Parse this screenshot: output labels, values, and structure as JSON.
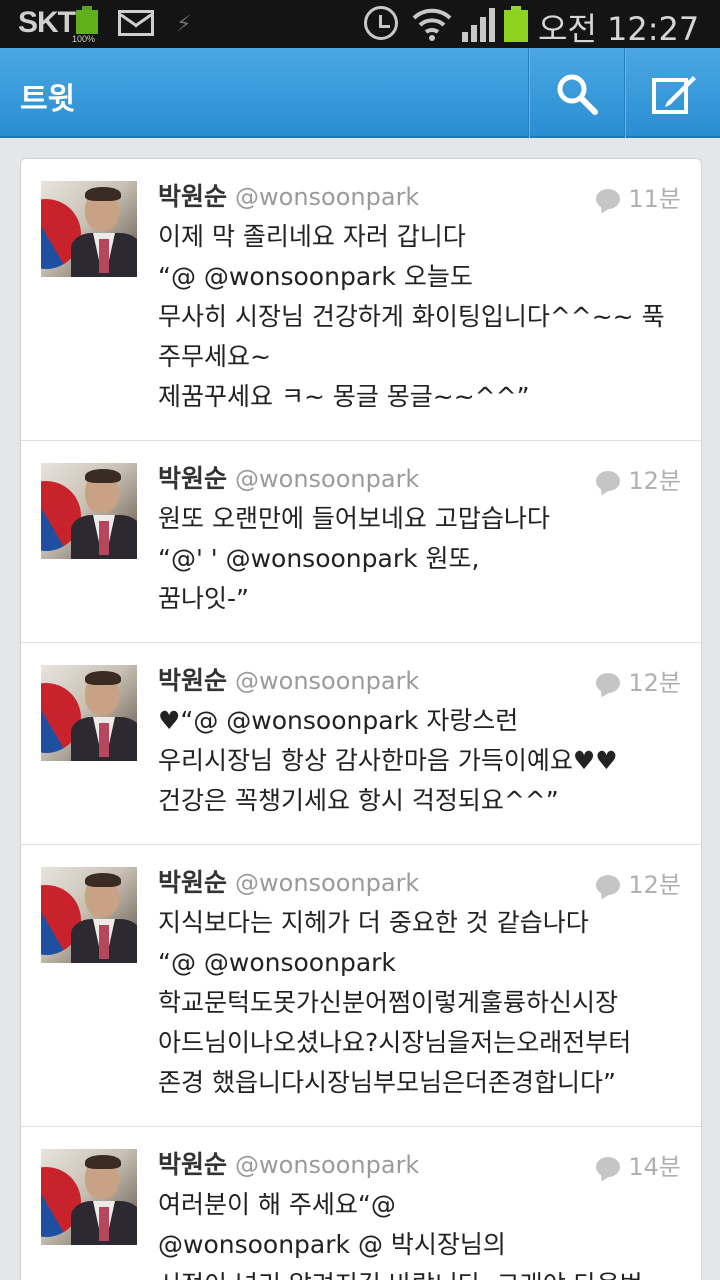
{
  "status_bar": {
    "carrier": "SKT",
    "battery_small_label": "100%",
    "time": "오전 12:27",
    "icons": [
      "battery-full-icon",
      "gmail-icon",
      "usb-icon",
      "alarm-icon",
      "wifi-icon",
      "signal-icon",
      "battery-icon"
    ]
  },
  "action_bar": {
    "title": "트윗",
    "search_icon": "search-icon",
    "compose_icon": "compose-icon",
    "colors": {
      "bar_top": "#4aa7e3",
      "bar_bottom": "#2b8ed2"
    }
  },
  "tweets": [
    {
      "name": "박원순",
      "handle": "@wonsoonpark",
      "time": "11분",
      "lines": [
        "이제 막 졸리네요 자러 갑니다",
        "“@                    @wonsoonpark 오늘도",
        "무사히 시장님 건강하게 화이팅입니다^^~~ 푹",
        "주무세요~",
        "제꿈꾸세요 ㅋ~ 몽글 몽글~~^^”"
      ]
    },
    {
      "name": "박원순",
      "handle": "@wonsoonpark",
      "time": "12분",
      "lines": [
        "원또 오랜만에 들어보네요 고맙습나다",
        "“@'          '         @wonsoonpark 원또,",
        "꿈나잇-”"
      ]
    },
    {
      "name": "박원순",
      "handle": "@wonsoonpark",
      "time": "12분",
      "lines": [
        "♥“@                  @wonsoonpark  자랑스런",
        "우리시장님 항상 감사한마음 가득이예요♥♥",
        "건강은 꼭챙기세요 항시 걱정되요^^”"
      ]
    },
    {
      "name": "박원순",
      "handle": "@wonsoonpark",
      "time": "12분",
      "lines": [
        "지식보다는 지헤가 더 중요한 것 같습나다",
        "“@                    @wonsoonpark",
        "학교문턱도못가신분어쩜이렇게훌륭하신시장",
        "아드님이나오셨나요?시장님을저는오래전부터",
        "존경 했읍니다시장님부모님은더존경합니다”"
      ]
    },
    {
      "name": "박원순",
      "handle": "@wonsoonpark",
      "time": "14분",
      "lines": [
        "여러분이 해 주세요“@",
        "@wonsoonpark @                     박시장님의",
        "시정이 널리 알려지길 바랍니다. 그래야 다음번"
      ]
    }
  ]
}
